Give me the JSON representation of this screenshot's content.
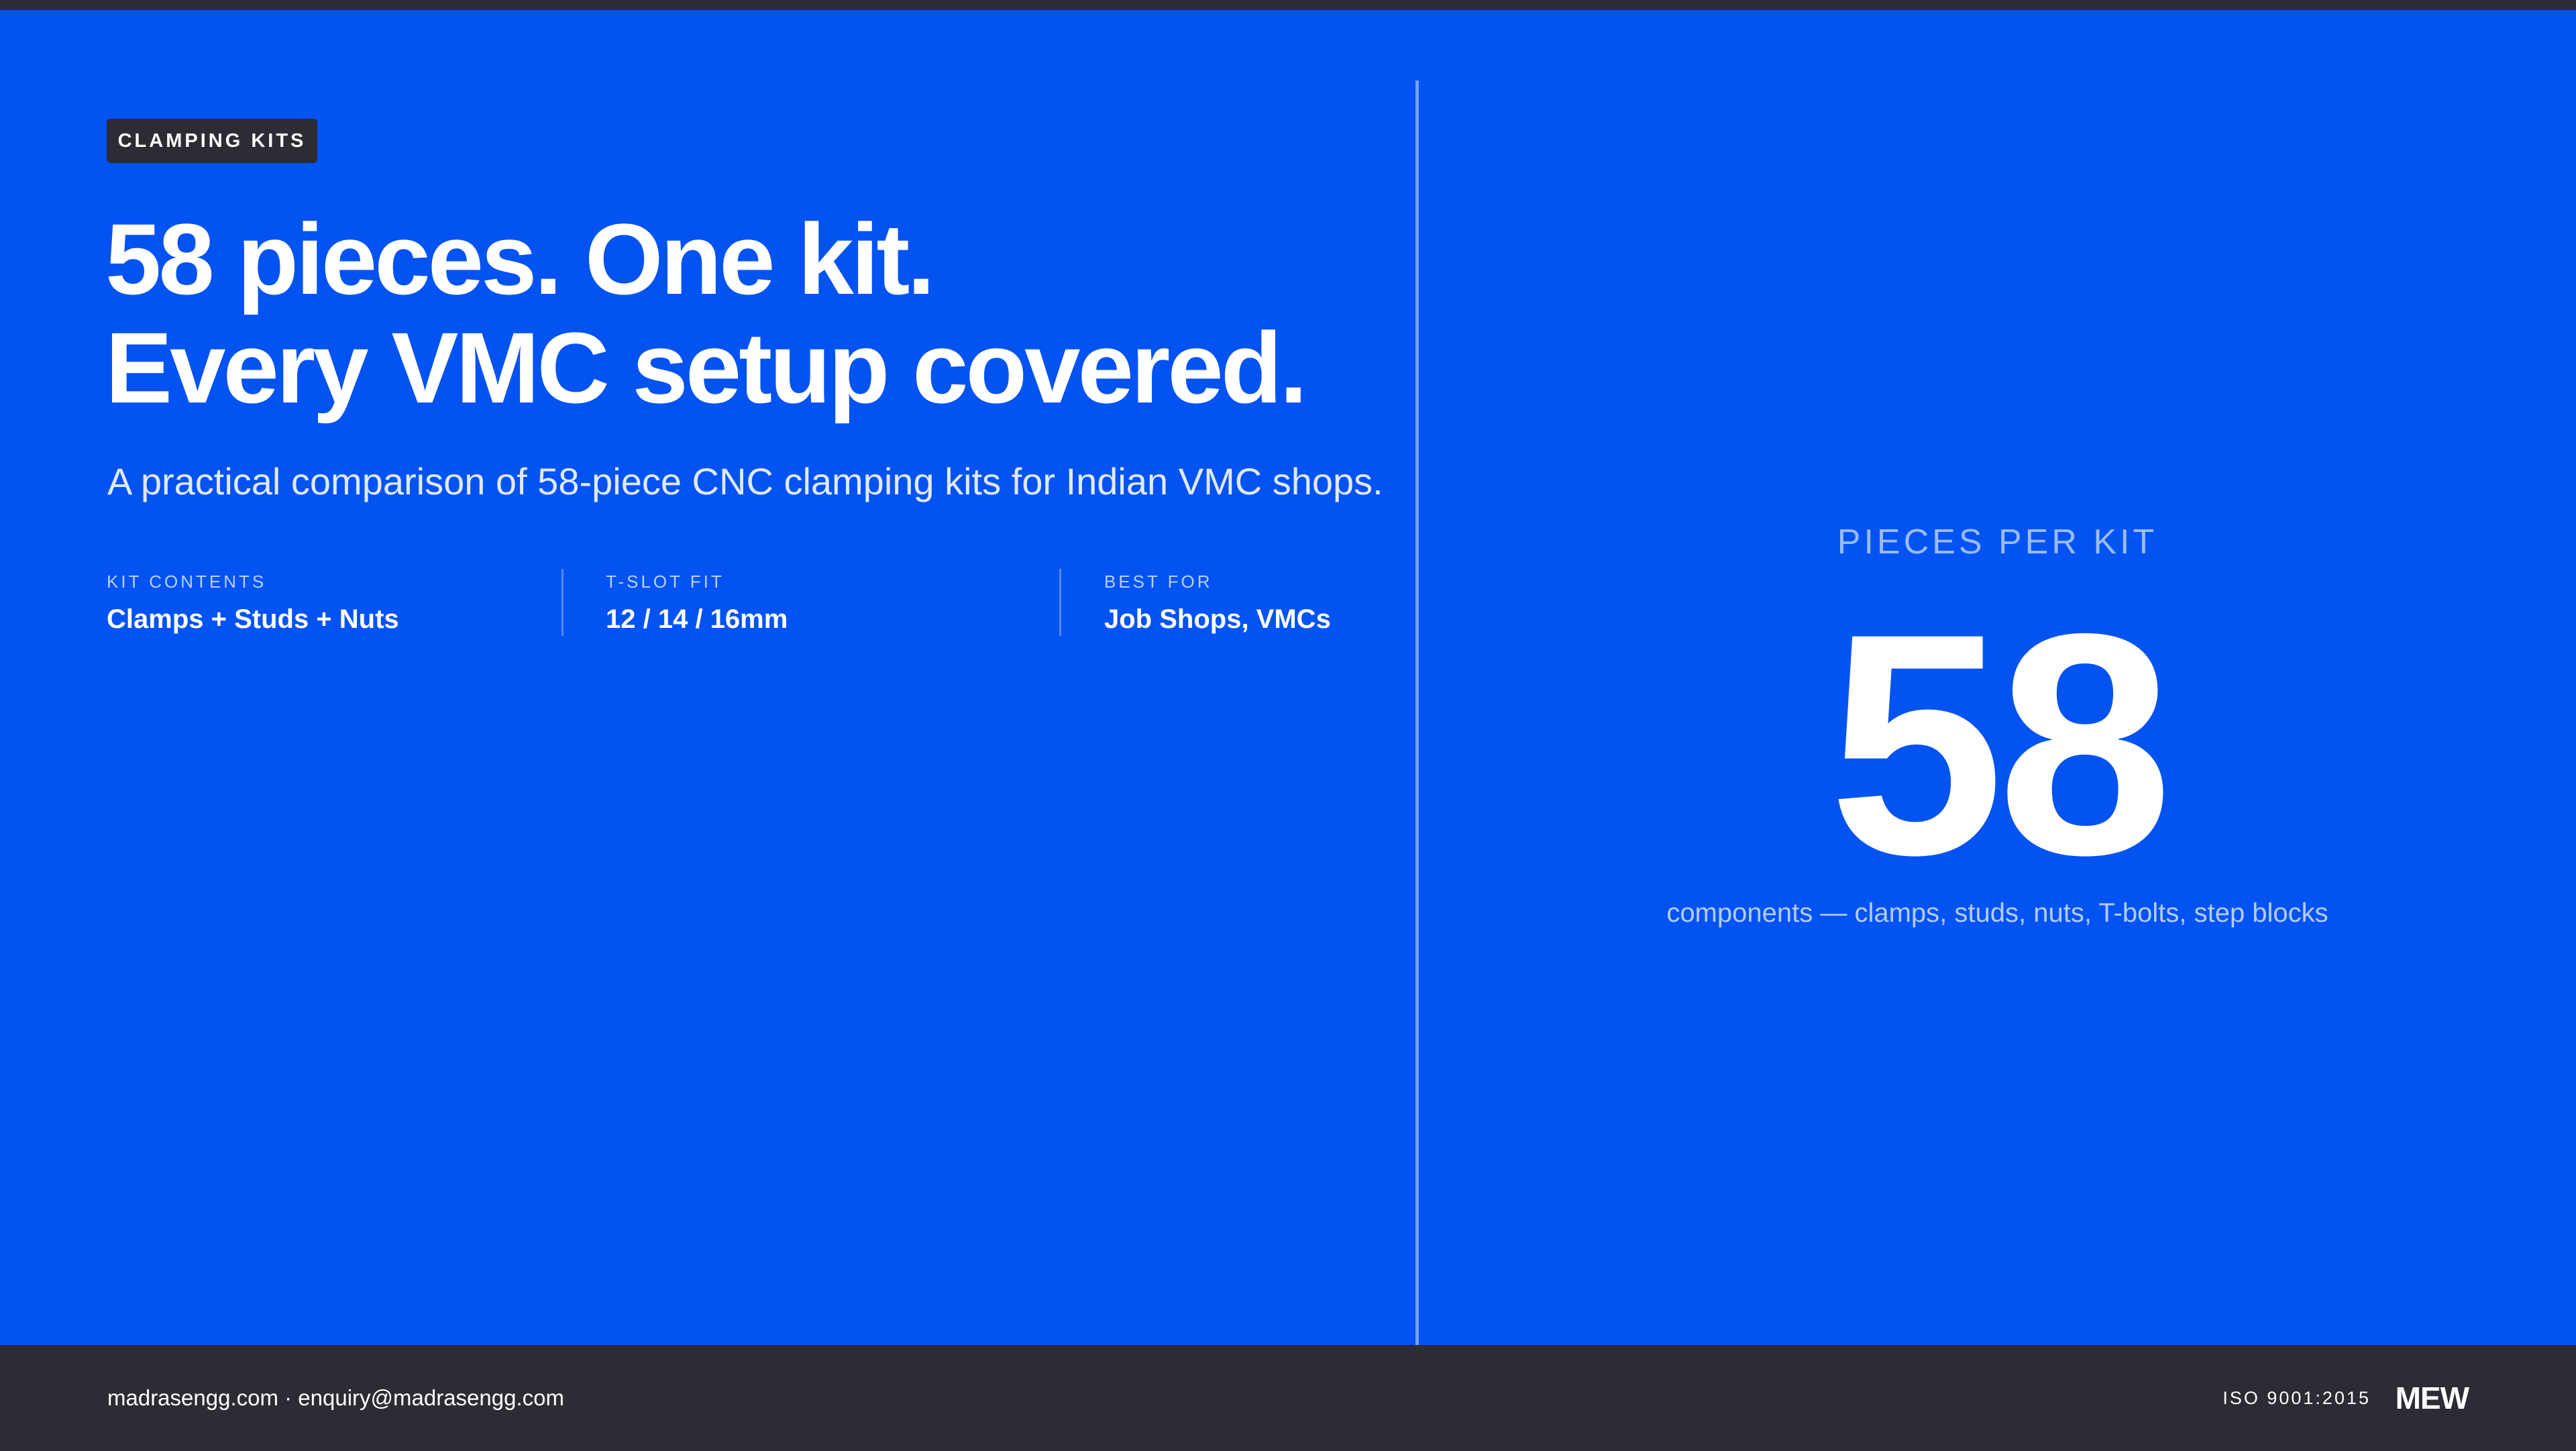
{
  "tag": "CLAMPING KITS",
  "headline": {
    "line1": "58 pieces. One kit.",
    "line2": "Every VMC setup covered."
  },
  "subhead": "A practical comparison of 58-piece CNC clamping kits for Indian VMC shops.",
  "specs": [
    {
      "label": "KIT CONTENTS",
      "value": "Clamps + Studs + Nuts"
    },
    {
      "label": "T-SLOT FIT",
      "value": "12 / 14 / 16mm"
    },
    {
      "label": "BEST FOR",
      "value": "Job Shops, VMCs"
    }
  ],
  "stat": {
    "label": "PIECES PER KIT",
    "number": "58",
    "caption": "components — clamps, studs, nuts, T-bolts, step blocks"
  },
  "footer": {
    "contact": "madrasengg.com · enquiry@madrasengg.com",
    "certification": "ISO 9001:2015",
    "logo": "MEW"
  },
  "colors": {
    "background": "#0353f2",
    "dark": "#2c2c34",
    "text": "#ffffff"
  }
}
